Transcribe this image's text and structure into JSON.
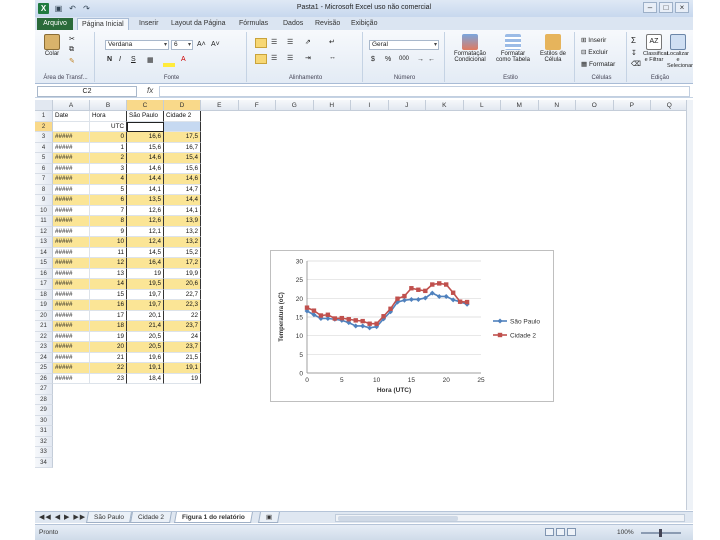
{
  "title": "Pasta1 - Microsoft Excel uso não comercial",
  "app_icon": "X",
  "qat": [
    "save-icon",
    "undo-icon",
    "redo-icon"
  ],
  "window_buttons": [
    "–",
    "□",
    "×"
  ],
  "tabs": [
    "Arquivo",
    "Página Inicial",
    "Inserir",
    "Layout da Página",
    "Fórmulas",
    "Dados",
    "Revisão",
    "Exibição"
  ],
  "active_tab": 1,
  "ribbon": {
    "clipboard": {
      "paste": "Colar",
      "label": "Área de Transf..."
    },
    "font": {
      "name": "Verdana",
      "size": "6",
      "bold": "N",
      "italic": "I",
      "underline": "S",
      "label": "Fonte",
      "grow": "A˄",
      "shrink": "A˅"
    },
    "alignment": {
      "label": "Alinhamento"
    },
    "number": {
      "format": "Geral",
      "currency": "$",
      "percent": "%",
      "thousands": "000",
      "label": "Número"
    },
    "styles": {
      "cond": "Formatação Condicional",
      "table": "Formatar como Tabela",
      "cell": "Estilos de Célula",
      "label": "Estilo"
    },
    "cells": {
      "insert": "Inserir",
      "delete": "Excluir",
      "format": "Formatar",
      "label": "Células"
    },
    "editing": {
      "sort": "Classificar e Filtrar",
      "find": "Localizar e Selecionar",
      "label": "Edição"
    }
  },
  "formula_bar": {
    "name_box": "C2",
    "fx": "fx",
    "value": ""
  },
  "columns": [
    "A",
    "B",
    "C",
    "D",
    "E",
    "F",
    "G",
    "H",
    "I",
    "J",
    "K",
    "L",
    "M",
    "N",
    "O",
    "P",
    "Q"
  ],
  "header_row": [
    "Date",
    "Hora",
    "São Paulo",
    "Cidade 2"
  ],
  "unit_row": [
    "",
    "UTC",
    "",
    ""
  ],
  "rows": [
    [
      "#####",
      "0",
      "16,6",
      "17,5"
    ],
    [
      "#####",
      "1",
      "15,6",
      "16,7"
    ],
    [
      "#####",
      "2",
      "14,6",
      "15,4"
    ],
    [
      "#####",
      "3",
      "14,6",
      "15,6"
    ],
    [
      "#####",
      "4",
      "14,4",
      "14,6"
    ],
    [
      "#####",
      "5",
      "14,1",
      "14,7"
    ],
    [
      "#####",
      "6",
      "13,5",
      "14,4"
    ],
    [
      "#####",
      "7",
      "12,6",
      "14,1"
    ],
    [
      "#####",
      "8",
      "12,6",
      "13,9"
    ],
    [
      "#####",
      "9",
      "12,1",
      "13,2"
    ],
    [
      "#####",
      "10",
      "12,4",
      "13,2"
    ],
    [
      "#####",
      "11",
      "14,5",
      "15,2"
    ],
    [
      "#####",
      "12",
      "16,4",
      "17,2"
    ],
    [
      "#####",
      "13",
      "19",
      "19,9"
    ],
    [
      "#####",
      "14",
      "19,5",
      "20,6"
    ],
    [
      "#####",
      "15",
      "19,7",
      "22,7"
    ],
    [
      "#####",
      "16",
      "19,7",
      "22,3"
    ],
    [
      "#####",
      "17",
      "20,1",
      "22"
    ],
    [
      "#####",
      "18",
      "21,4",
      "23,7"
    ],
    [
      "#####",
      "19",
      "20,5",
      "24"
    ],
    [
      "#####",
      "20",
      "20,5",
      "23,7"
    ],
    [
      "#####",
      "21",
      "19,6",
      "21,5"
    ],
    [
      "#####",
      "22",
      "19,1",
      "19,1"
    ],
    [
      "#####",
      "23",
      "18,4",
      "19"
    ]
  ],
  "empty_row_numbers": [
    "27",
    "28",
    "29",
    "30",
    "31",
    "32",
    "33",
    "34"
  ],
  "sheet_tabs": [
    "São Paulo",
    "Cidade 2",
    "Figura 1 do relatório"
  ],
  "active_sheet": 2,
  "status": {
    "text": "Pronto",
    "zoom": "100%"
  },
  "colors": {
    "highlight": "#fbe596",
    "series1": "#4f81bd",
    "series2": "#c0504d"
  },
  "chart_data": {
    "type": "line",
    "title": "",
    "xlabel": "Hora (UTC)",
    "ylabel": "Temperatura (oC)",
    "xlim": [
      0,
      25
    ],
    "ylim": [
      0,
      30
    ],
    "xticks": [
      0,
      5,
      10,
      15,
      20,
      25
    ],
    "yticks": [
      0,
      5,
      10,
      15,
      20,
      25,
      30
    ],
    "grid": "horizontal",
    "legend": "right",
    "x": [
      0,
      1,
      2,
      3,
      4,
      5,
      6,
      7,
      8,
      9,
      10,
      11,
      12,
      13,
      14,
      15,
      16,
      17,
      18,
      19,
      20,
      21,
      22,
      23
    ],
    "series": [
      {
        "name": "São Paulo",
        "color": "#4f81bd",
        "marker": "diamond",
        "values": [
          16.6,
          15.6,
          14.6,
          14.6,
          14.4,
          14.1,
          13.5,
          12.6,
          12.6,
          12.1,
          12.4,
          14.5,
          16.4,
          19,
          19.5,
          19.7,
          19.7,
          20.1,
          21.4,
          20.5,
          20.5,
          19.6,
          19.1,
          18.4
        ]
      },
      {
        "name": "Cidade 2",
        "color": "#c0504d",
        "marker": "square",
        "values": [
          17.5,
          16.7,
          15.4,
          15.6,
          14.6,
          14.7,
          14.4,
          14.1,
          13.9,
          13.2,
          13.2,
          15.2,
          17.2,
          19.9,
          20.6,
          22.7,
          22.3,
          22,
          23.7,
          24,
          23.7,
          21.5,
          19.1,
          19
        ]
      }
    ]
  }
}
